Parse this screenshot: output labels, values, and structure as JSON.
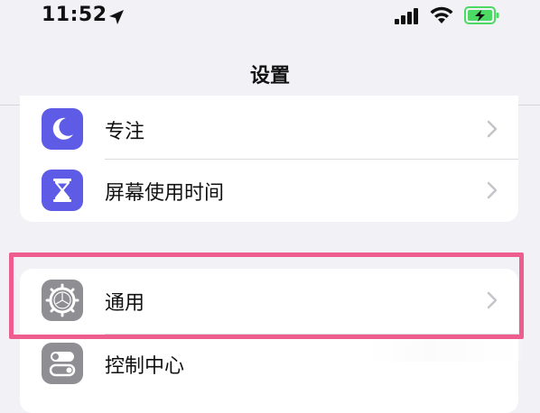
{
  "status_bar": {
    "time": "11:52",
    "location_icon": "location-arrow-icon",
    "signal_icon": "cellular-signal-icon",
    "wifi_icon": "wifi-icon",
    "battery_icon": "battery-charging-icon",
    "battery_color": "#4cd964"
  },
  "nav": {
    "title": "设置"
  },
  "group1": {
    "items": [
      {
        "label": "专注",
        "icon": "moon-icon",
        "icon_color": "#5e5ce6"
      },
      {
        "label": "屏幕使用时间",
        "icon": "hourglass-icon",
        "icon_color": "#5e5ce6"
      }
    ]
  },
  "group2": {
    "items": [
      {
        "label": "通用",
        "icon": "gear-icon",
        "icon_color": "#8e8e93"
      },
      {
        "label": "控制中心",
        "icon": "toggle-switches-icon",
        "icon_color": "#8e8e93"
      }
    ]
  },
  "highlight": {
    "color": "#ed5e8e",
    "target": "通用"
  },
  "colors": {
    "background": "#f2f1f6",
    "cell": "#ffffff",
    "chevron": "#c4c4c9"
  }
}
